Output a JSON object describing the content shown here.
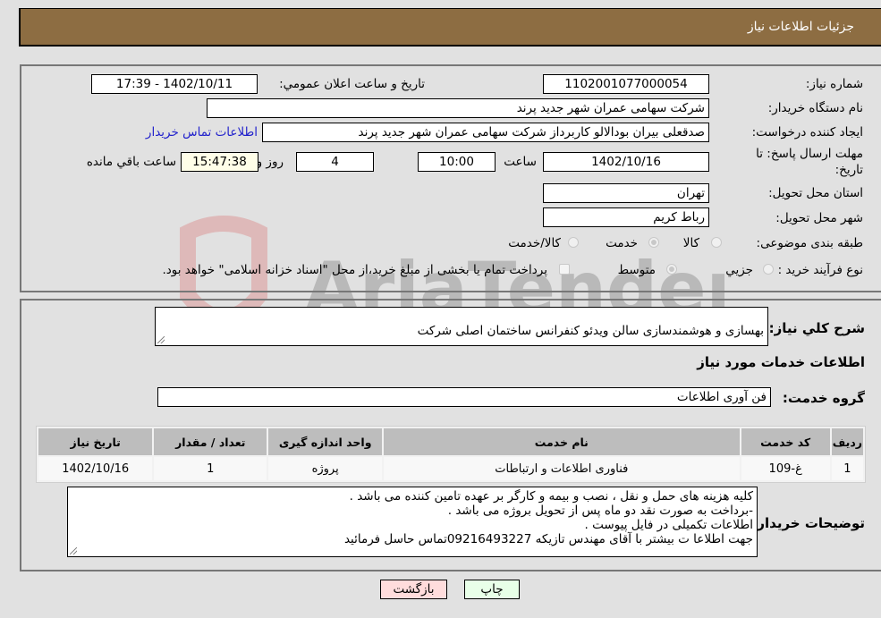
{
  "header": {
    "title": "جزئیات اطلاعات نیاز"
  },
  "details": {
    "need_number_label": "شماره نیاز:",
    "need_number": "1102001077000054",
    "announce_label": "تاریخ و ساعت اعلان عمومي:",
    "announce_value": "1402/10/11 - 17:39",
    "buyer_org_label": "نام دستگاه خریدار:",
    "buyer_org": "شرکت سهامی عمران شهر جدید پرند",
    "requester_label": "ایجاد کننده درخواست:",
    "requester": "صدقعلی بیران بودالالو کاربرداز شرکت سهامی عمران شهر جدید پرند",
    "buyer_contact_link": "اطلاعات تماس خریدار",
    "deadline_label": "مهلت ارسال پاسخ: تا تاریخ:",
    "deadline_date": "1402/10/16",
    "time_label": "ساعت",
    "deadline_time": "10:00",
    "days_value": "4",
    "days_label": "روز و",
    "remaining_time": "15:47:38",
    "remaining_label": "ساعت باقي مانده",
    "province_label": "استان محل تحویل:",
    "province": "تهران",
    "city_label": "شهر محل تحویل:",
    "city": "رباط کریم",
    "category_label": "طبقه بندی موضوعی:",
    "category_options": [
      {
        "label": "کالا",
        "checked": false
      },
      {
        "label": "خدمت",
        "checked": true
      },
      {
        "label": "کالا/خدمت",
        "checked": false
      }
    ],
    "process_label": "نوع فرآیند خرید :",
    "process_options": [
      {
        "label": "جزيي",
        "checked": false
      },
      {
        "label": "متوسط",
        "checked": true
      }
    ],
    "treasury_note": "پرداخت تمام یا بخشی از مبلغ خرید،از محل \"اسناد خزانه اسلامی\" خواهد بود.",
    "treasury_checked": false
  },
  "description": {
    "label": "شرح کلي نیاز:",
    "value": "بهسازی و هوشمندسازی سالن ویدئو کنفرانس ساختمان اصلی شرکت"
  },
  "services": {
    "section_title": "اطلاعات خدمات مورد نیاز",
    "group_label": "گروه خدمت:",
    "group_value": "فن آوری اطلاعات",
    "columns": [
      "ردیف",
      "کد خدمت",
      "نام خدمت",
      "واحد اندازه گیری",
      "تعداد / مقدار",
      "تاریخ نیاز"
    ],
    "rows": [
      {
        "index": "1",
        "code": "غ-109",
        "name": "فناوری اطلاعات و ارتباطات",
        "unit": "پروژه",
        "qty": "1",
        "date": "1402/10/16"
      }
    ]
  },
  "buyer_notes": {
    "label": "توضیحات خریدار:",
    "lines": [
      "کلیه هزینه های حمل و نقل ، نصب و بیمه و کارگر بر عهده تامین کننده  می باشد .",
      "-برداخت به صورت نقد دو ماه پس از تحویل بروژه  می باشد .",
      "اطلاعات تکمیلی در فایل پیوست .",
      "جهت اطلاعا ت بیشتر با آقای مهندس تازیکه 09216493227تماس حاسل فرمائید"
    ]
  },
  "buttons": {
    "print": "چاپ",
    "back": "بازگشت"
  },
  "watermark": {
    "text": "AriaTender.neT"
  }
}
